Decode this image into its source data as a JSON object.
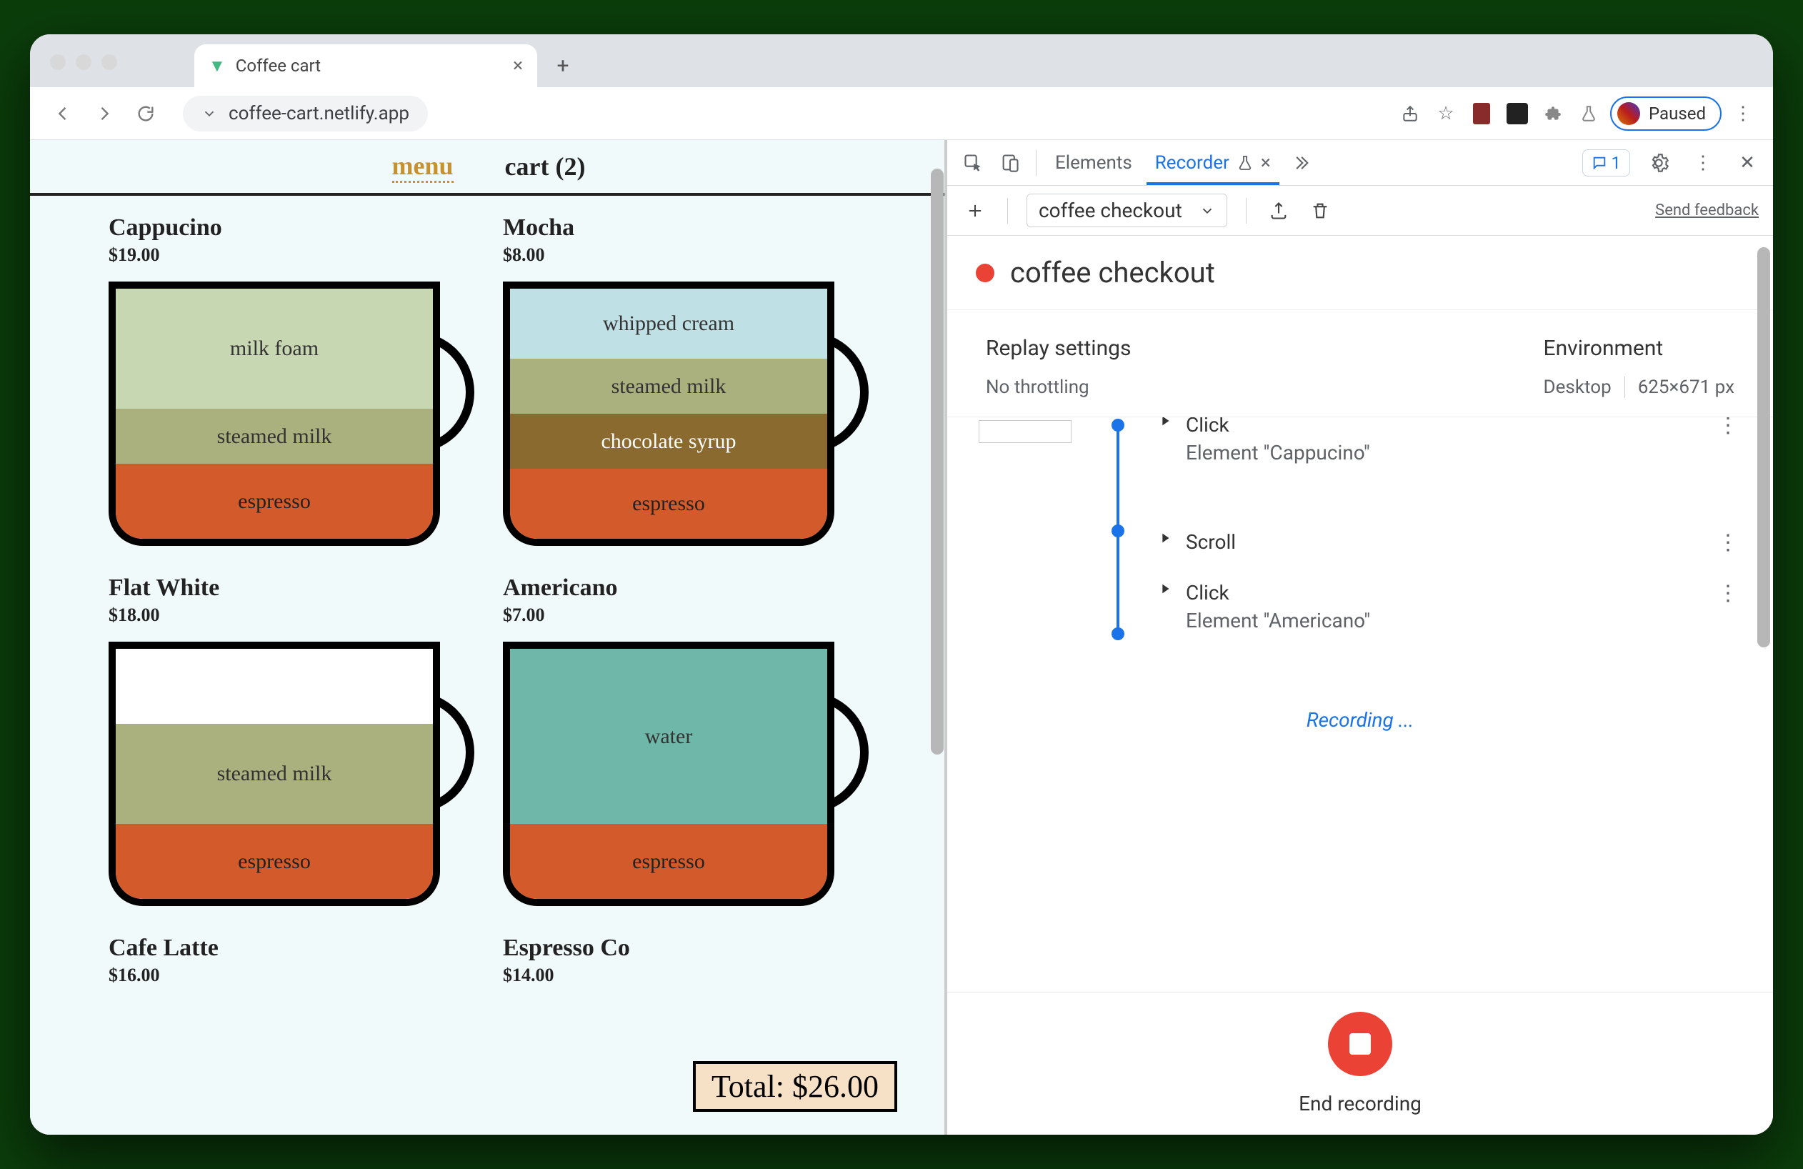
{
  "browser": {
    "tab_title": "Coffee cart",
    "url": "coffee-cart.netlify.app",
    "paused_label": "Paused"
  },
  "page": {
    "nav": {
      "menu": "menu",
      "cart": "cart (2)"
    },
    "products": [
      {
        "name": "Cappucino",
        "price": "$19.00",
        "layers": [
          {
            "label": "espresso",
            "cls": "espressoL",
            "h": "30%"
          },
          {
            "label": "steamed milk",
            "cls": "steamedmilk",
            "h": "22%"
          },
          {
            "label": "milk foam",
            "cls": "milkfoam",
            "h": "48%"
          }
        ]
      },
      {
        "name": "Mocha",
        "price": "$8.00",
        "layers": [
          {
            "label": "espresso",
            "cls": "espressoL",
            "h": "28%"
          },
          {
            "label": "chocolate syrup",
            "cls": "choc",
            "h": "22%"
          },
          {
            "label": "steamed milk",
            "cls": "steamedmilk",
            "h": "22%"
          },
          {
            "label": "whipped cream",
            "cls": "whipped",
            "h": "28%"
          }
        ]
      },
      {
        "name": "Flat White",
        "price": "$18.00",
        "layers": [
          {
            "label": "espresso",
            "cls": "espressoL",
            "h": "30%"
          },
          {
            "label": "steamed milk",
            "cls": "steamedmilk",
            "h": "40%"
          }
        ]
      },
      {
        "name": "Americano",
        "price": "$7.00",
        "layers": [
          {
            "label": "espresso",
            "cls": "espressoL",
            "h": "30%"
          },
          {
            "label": "water",
            "cls": "water",
            "h": "70%"
          }
        ]
      },
      {
        "name": "Cafe Latte",
        "price": "$16.00",
        "layers": []
      },
      {
        "name": "Espresso Co",
        "price": "$14.00",
        "layers": []
      }
    ],
    "total": "Total: $26.00"
  },
  "devtools": {
    "tabs": {
      "elements": "Elements",
      "recorder": "Recorder"
    },
    "msg_count": "1",
    "toolbar": {
      "recording_name": "coffee checkout",
      "feedback": "Send feedback"
    },
    "title": "coffee checkout",
    "settings": {
      "replay_h": "Replay settings",
      "replay_v": "No throttling",
      "env_h": "Environment",
      "env_device": "Desktop",
      "env_size": "625×671 px"
    },
    "steps": [
      {
        "title": "Click",
        "sub": "Element \"Cappucino\""
      },
      {
        "title": "Scroll",
        "sub": ""
      },
      {
        "title": "Click",
        "sub": "Element \"Americano\""
      }
    ],
    "recording_label": "Recording ...",
    "end_label": "End recording"
  }
}
